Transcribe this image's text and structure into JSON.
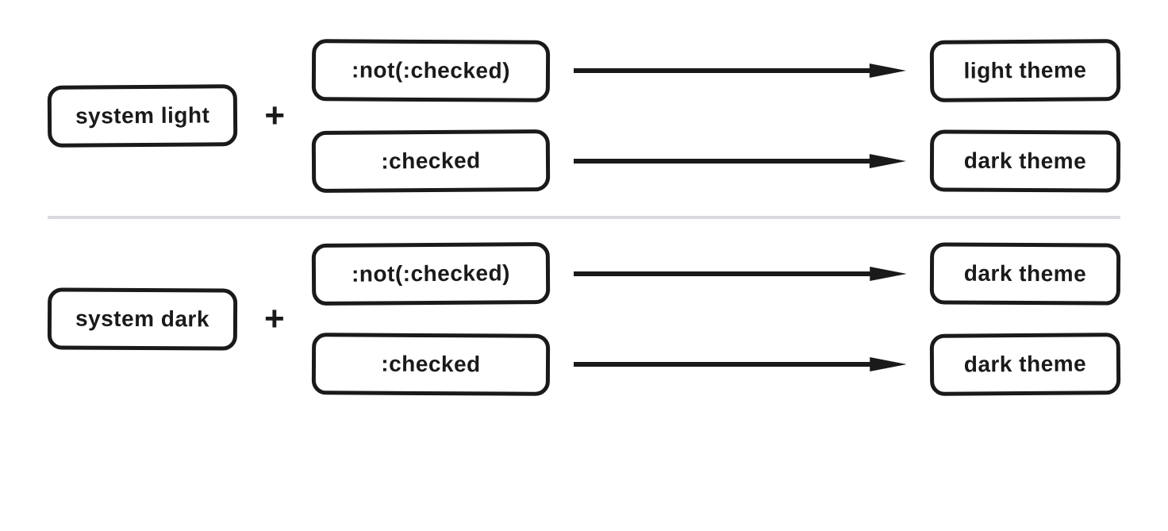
{
  "sections": [
    {
      "system": "system light",
      "plus": "+",
      "branches": [
        {
          "selector": ":not(:checked)",
          "result": "light theme"
        },
        {
          "selector": ":checked",
          "result": "dark theme"
        }
      ]
    },
    {
      "system": "system dark",
      "plus": "+",
      "branches": [
        {
          "selector": ":not(:checked)",
          "result": "dark theme"
        },
        {
          "selector": ":checked",
          "result": "dark theme"
        }
      ]
    }
  ]
}
